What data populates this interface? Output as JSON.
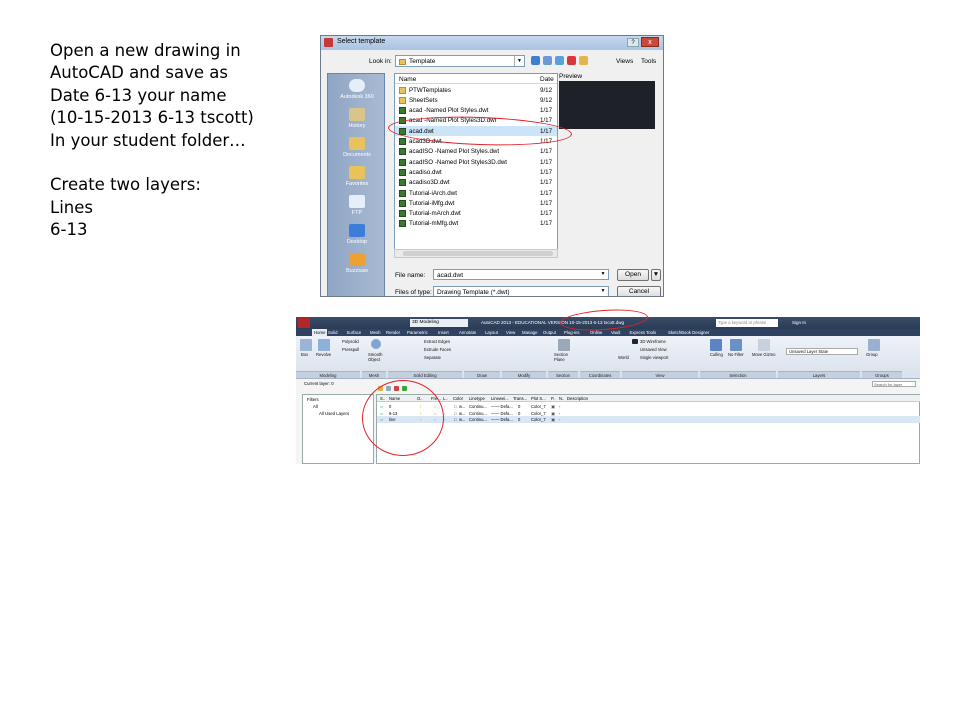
{
  "slide": {
    "lines": [
      "Open a new drawing in",
      "AutoCAD and save as",
      "Date 6-13 your name",
      "(10-15-2013  6-13 tscott)",
      "In your student folder…",
      "",
      "Create two layers:",
      "Lines",
      "6-13"
    ]
  },
  "dialog": {
    "title": "Select template",
    "look_in_label": "Look in:",
    "look_in_value": "Template",
    "views_label": "Views",
    "tools_label": "Tools",
    "places": [
      "Autodesk 360",
      "History",
      "Documents",
      "Favorites",
      "FTP",
      "Desktop",
      "Buzzsaw"
    ],
    "columns": {
      "name": "Name",
      "date": "Date"
    },
    "preview_label": "Preview",
    "files": [
      {
        "name": "PTWTemplates",
        "date": "9/12",
        "kind": "folder"
      },
      {
        "name": "SheetSets",
        "date": "9/12",
        "kind": "folder"
      },
      {
        "name": "acad -Named Plot Styles.dwt",
        "date": "1/17",
        "kind": "dwt"
      },
      {
        "name": "acad -Named Plot Styles3D.dwt",
        "date": "1/17",
        "kind": "dwt"
      },
      {
        "name": "acad.dwt",
        "date": "1/17",
        "kind": "dwt",
        "selected": true
      },
      {
        "name": "acad3D.dwt",
        "date": "1/17",
        "kind": "dwt"
      },
      {
        "name": "acadISO -Named Plot Styles.dwt",
        "date": "1/17",
        "kind": "dwt"
      },
      {
        "name": "acadISO -Named Plot Styles3D.dwt",
        "date": "1/17",
        "kind": "dwt"
      },
      {
        "name": "acadiso.dwt",
        "date": "1/17",
        "kind": "dwt"
      },
      {
        "name": "acadiso3D.dwt",
        "date": "1/17",
        "kind": "dwt"
      },
      {
        "name": "Tutorial-iArch.dwt",
        "date": "1/17",
        "kind": "dwt"
      },
      {
        "name": "Tutorial-iMfg.dwt",
        "date": "1/17",
        "kind": "dwt"
      },
      {
        "name": "Tutorial-mArch.dwt",
        "date": "1/17",
        "kind": "dwt"
      },
      {
        "name": "Tutorial-mMfg.dwt",
        "date": "1/17",
        "kind": "dwt"
      }
    ],
    "file_name_label": "File name:",
    "file_name_value": "acad.dwt",
    "file_type_label": "Files of type:",
    "file_type_value": "Drawing Template (*.dwt)",
    "open_button": "Open",
    "cancel_button": "Cancel",
    "close_symbol": "x",
    "help_symbol": "?"
  },
  "acad": {
    "workspace": "3D Modeling",
    "title": "AutoCAD 2013 - EDUCATIONAL VERSION    10-15-2013 6-13 tscott.dwg",
    "search_placeholder": "Type a keyword or phrase",
    "sign_in": "Sign In",
    "tabs": [
      "Home",
      "Solid",
      "Surface",
      "Mesh",
      "Render",
      "Parametric",
      "Insert",
      "Annotate",
      "Layout",
      "View",
      "Manage",
      "Output",
      "Plug-ins",
      "Online",
      "Vault",
      "Express Tools",
      "SketchBook Designer"
    ],
    "ribbon": {
      "box": "Box",
      "revolve": "Revolve",
      "polysolid": "Polysolid",
      "presspull": "Presspull",
      "smooth_object": "Smooth Object",
      "extract_edges": "Extract Edges",
      "extrude_faces": "Extrude Faces",
      "separate": "Separate",
      "section_plane": "Section Plane",
      "visual_style": "3D Wireframe",
      "view": "Unsaved View",
      "ucs": "World",
      "viewport": "Single viewport",
      "culling": "Culling",
      "no_filter": "No Filter",
      "move_gizmo": "Move Gizmo",
      "layer_state": "Unsaved Layer State",
      "group": "Group",
      "panels": [
        "Modeling",
        "Mesh",
        "Solid Editing",
        "Draw",
        "Modify",
        "Section",
        "Coordinates",
        "View",
        "Selection",
        "Layers",
        "Groups"
      ]
    },
    "layer_manager": {
      "current_layer": "Current layer: 0",
      "search_placeholder": "Search for layer",
      "tree": [
        "Filters",
        "All",
        "All Used Layers"
      ],
      "columns": [
        "S..",
        "Name",
        "O..",
        "Fre...",
        "L..",
        "Color",
        "Linetype",
        "Linewei...",
        "Trans...",
        "Plot S...",
        "P..",
        "N..",
        "Description"
      ],
      "layers": [
        {
          "name": "0",
          "color": "w...",
          "linetype": "Continu...",
          "lineweight": "—— Defa...",
          "transparency": "0",
          "plot_style": "Color_7"
        },
        {
          "name": "6-13",
          "color": "w...",
          "linetype": "Continu...",
          "lineweight": "—— Defa...",
          "transparency": "0",
          "plot_style": "Color_7"
        },
        {
          "name": "line",
          "color": "w...",
          "linetype": "Continu...",
          "lineweight": "—— Defa...",
          "transparency": "0",
          "plot_style": "Color_7"
        }
      ]
    }
  },
  "colors": {
    "annotation": "#e0232a",
    "selection": "#cce4f7",
    "title_bar": "#2a3b55"
  }
}
